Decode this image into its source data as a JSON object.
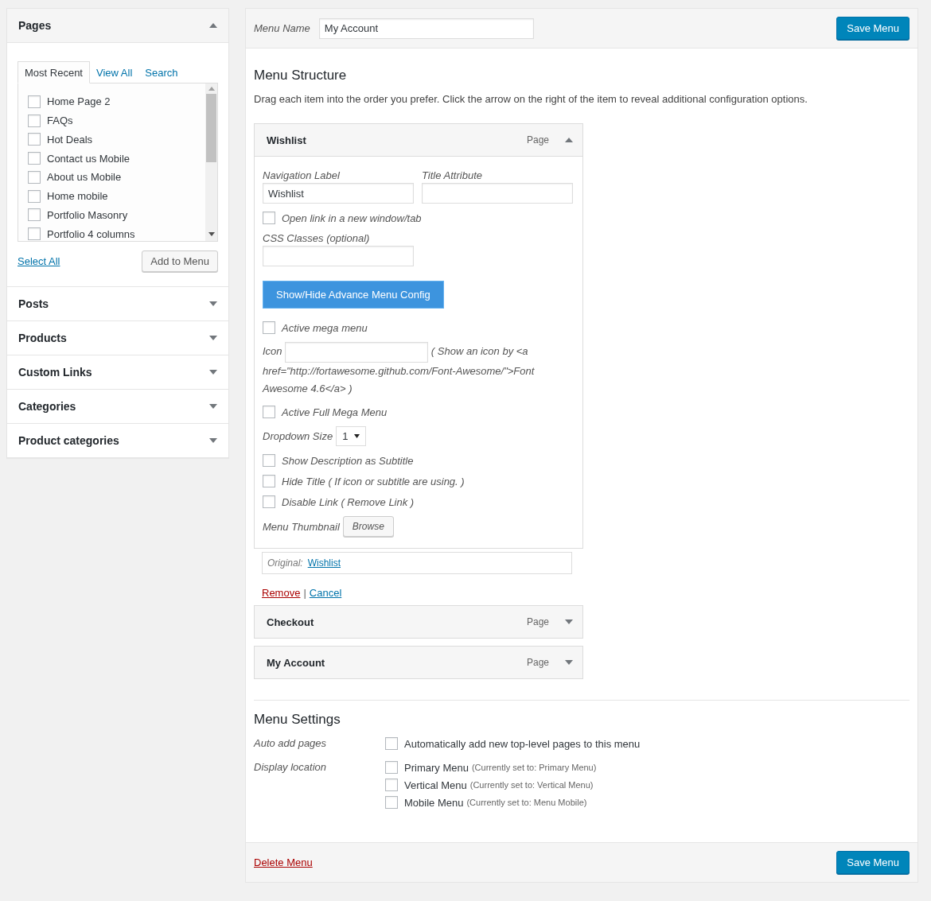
{
  "sidebar": {
    "pages": {
      "title": "Pages",
      "expanded": true,
      "tabs": [
        {
          "label": "Most Recent",
          "selected": true
        },
        {
          "label": "View All",
          "selected": false
        },
        {
          "label": "Search",
          "selected": false
        }
      ],
      "items": [
        {
          "label": "Home Page 2",
          "checked": false
        },
        {
          "label": "FAQs",
          "checked": false
        },
        {
          "label": "Hot Deals",
          "checked": false
        },
        {
          "label": "Contact us Mobile",
          "checked": false
        },
        {
          "label": "About us Mobile",
          "checked": false
        },
        {
          "label": "Home mobile",
          "checked": false
        },
        {
          "label": "Portfolio Masonry",
          "checked": false
        },
        {
          "label": "Portfolio 4 columns",
          "checked": false
        }
      ],
      "select_all": "Select All",
      "add_button": "Add to Menu"
    },
    "sections": [
      {
        "title": "Posts",
        "expanded": false
      },
      {
        "title": "Products",
        "expanded": false
      },
      {
        "title": "Custom Links",
        "expanded": false
      },
      {
        "title": "Categories",
        "expanded": false
      },
      {
        "title": "Product categories",
        "expanded": false
      }
    ]
  },
  "menu": {
    "name_label": "Menu Name",
    "name_value": "My Account",
    "save_button": "Save Menu",
    "structure": {
      "title": "Menu Structure",
      "description": "Drag each item into the order you prefer. Click the arrow on the right of the item to reveal additional configuration options.",
      "items": [
        {
          "title": "Wishlist",
          "type": "Page",
          "expanded": true,
          "settings": {
            "nav_label": {
              "label": "Navigation Label",
              "value": "Wishlist"
            },
            "title_attribute": {
              "label": "Title Attribute"
            },
            "new_window": {
              "label": "Open link in a new window/tab",
              "checked": false
            },
            "css_classes": {
              "label": "CSS Classes (optional)"
            },
            "advance_button": "Show/Hide Advance Menu Config",
            "advanced": [
              {
                "kind": "checkbox",
                "label": "Active mega menu",
                "checked": false
              },
              {
                "kind": "icon",
                "label": "Icon",
                "note": "( Show an icon by <a",
                "note_continued": "href=\"http://fortawesome.github.com/Font-Awesome/\">Font Awesome 4.6</a> )"
              },
              {
                "kind": "checkbox",
                "label": "Active Full Mega Menu",
                "checked": false
              },
              {
                "kind": "select",
                "label": "Dropdown Size",
                "value": "1"
              },
              {
                "kind": "checkbox",
                "label": "Show Description as Subtitle",
                "checked": false
              },
              {
                "kind": "checkbox",
                "label": "Hide Title ( If icon or subtitle are using. )",
                "checked": false
              },
              {
                "kind": "checkbox",
                "label": "Disable Link ( Remove Link )",
                "checked": false
              },
              {
                "kind": "browse",
                "label": "Menu Thumbnail",
                "button": "Browse"
              }
            ],
            "original_label": "Original:",
            "original_link": "Wishlist",
            "remove": "Remove",
            "separator": "|",
            "cancel": "Cancel"
          }
        },
        {
          "title": "Checkout",
          "type": "Page",
          "expanded": false
        },
        {
          "title": "My Account",
          "type": "Page",
          "expanded": false
        }
      ]
    },
    "settings": {
      "title": "Menu Settings",
      "groups": [
        {
          "label": "Auto add pages",
          "options": [
            {
              "label": "Automatically add new top-level pages to this menu",
              "checked": false
            }
          ]
        },
        {
          "label": "Display location",
          "options": [
            {
              "label": "Primary Menu",
              "note": "(Currently set to: Primary Menu)",
              "checked": false
            },
            {
              "label": "Vertical Menu",
              "note": "(Currently set to: Vertical Menu)",
              "checked": false
            },
            {
              "label": "Mobile Menu",
              "note": "(Currently set to: Menu Mobile)",
              "checked": false
            }
          ]
        }
      ]
    },
    "delete": "Delete Menu",
    "save_button_bottom": "Save Menu"
  }
}
